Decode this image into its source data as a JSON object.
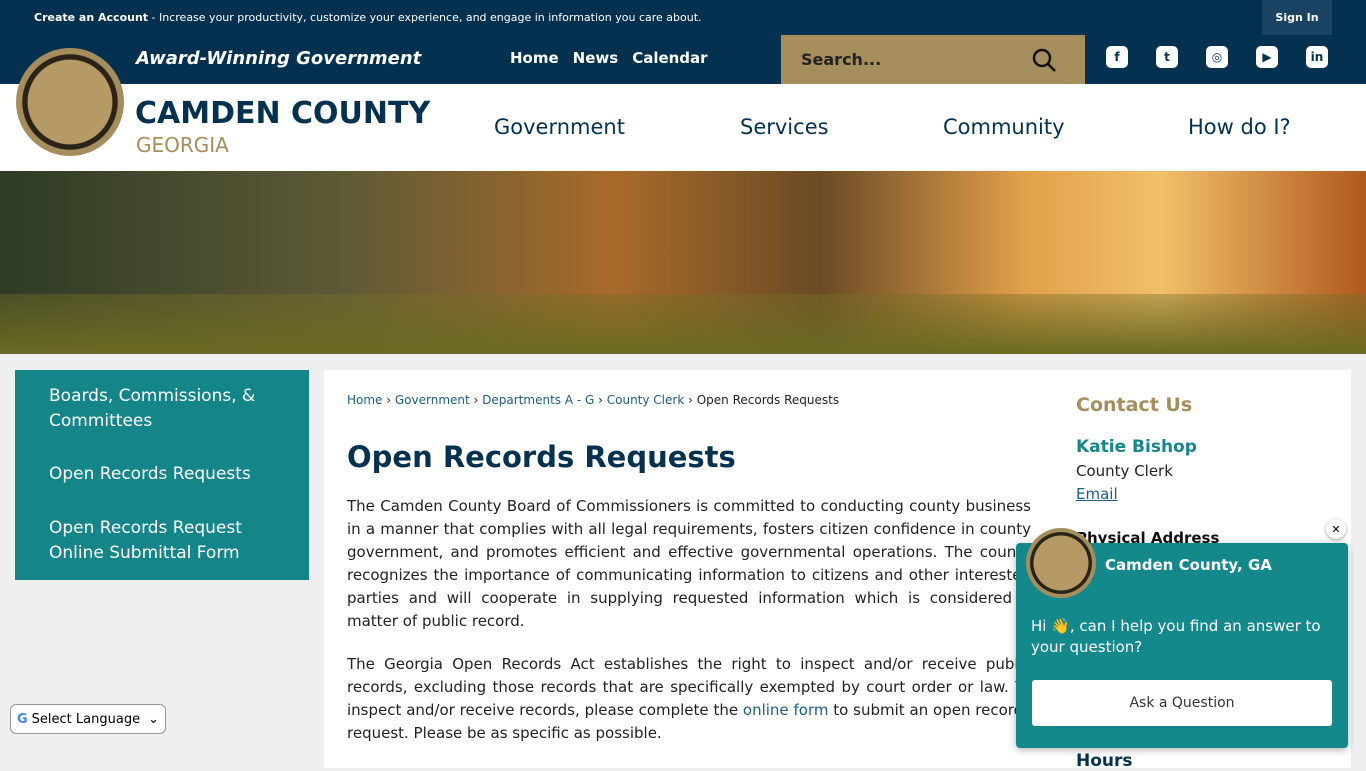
{
  "topbar": {
    "create_account": "Create an Account",
    "message": " - Increase your productivity, customize your experience, and engage in information you care about.",
    "sign_in": "Sign In"
  },
  "header": {
    "tagline": "Award-Winning Government",
    "quick_links": [
      "Home",
      "News",
      "Calendar"
    ],
    "search_placeholder": "Search...",
    "social": [
      "facebook-icon",
      "twitter-icon",
      "instagram-icon",
      "youtube-icon",
      "linkedin-icon"
    ],
    "logo_title": "CAMDEN COUNTY",
    "logo_subtitle": "GEORGIA",
    "nav": [
      "Government",
      "Services",
      "Community",
      "How do I?"
    ]
  },
  "sidebar": {
    "items": [
      "Boards, Commissions, & Committees",
      "Open Records Requests",
      "Open Records Request Online Submittal Form"
    ]
  },
  "breadcrumb": [
    "Home",
    "Government",
    "Departments A - G",
    "County Clerk",
    "Open Records Requests"
  ],
  "main": {
    "title": "Open Records Requests",
    "p1": "The Camden County Board of Commissioners is committed to conducting county business in a manner that complies with all legal requirements, fosters citizen confidence in county government, and promotes efficient and effective governmental operations. The county recognizes the importance of communicating information to citizens and other interested parties and will cooperate in supplying requested information which is considered a matter of public record.",
    "p2a": "The Georgia Open Records Act establishes the right to inspect and/or receive public records, excluding those records that are specifically exempted by court order or law. To inspect and/or receive records, please complete the ",
    "p2link": "online form",
    "p2b": " to submit an open records request. Please be as specific as possible."
  },
  "contact": {
    "heading": "Contact Us",
    "name": "Katie Bishop",
    "role": "County Clerk",
    "email": "Email",
    "address_heading": "Physical Address",
    "hours_heading": "Hours"
  },
  "language": {
    "selected": "Select Language"
  },
  "chat": {
    "title": "Camden County, GA",
    "message": "Hi 👋, can I help you find an answer to your question?",
    "button": "Ask a Question"
  },
  "colors": {
    "navy": "#03314f",
    "gold": "#a68d5c",
    "teal": "#14868a"
  }
}
